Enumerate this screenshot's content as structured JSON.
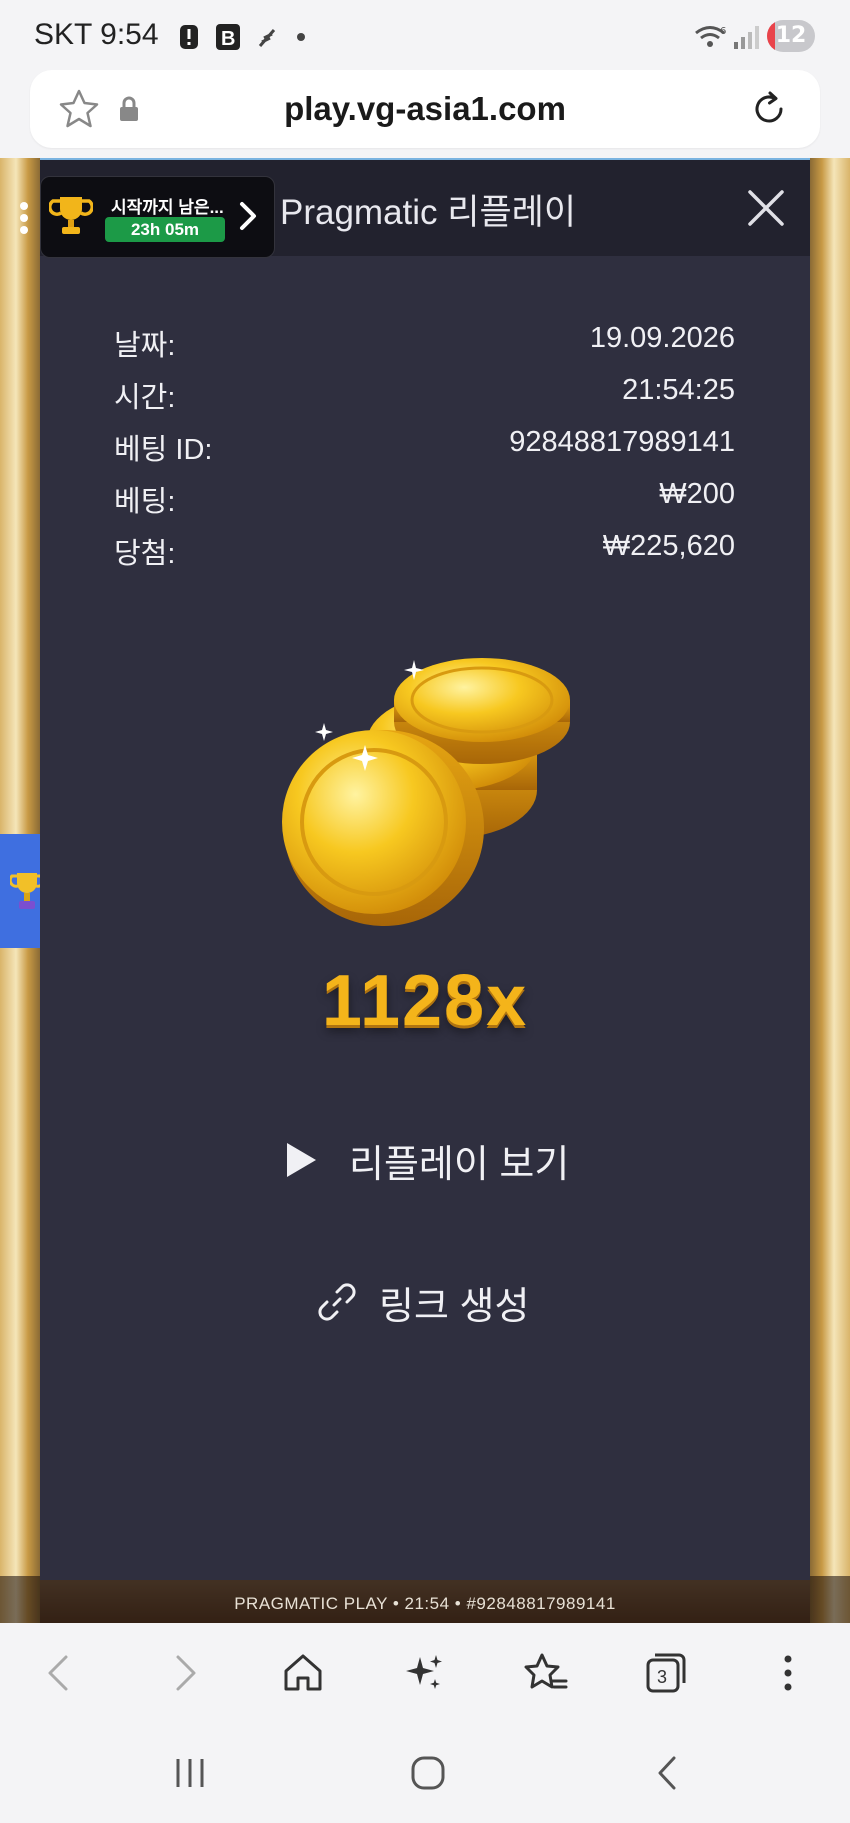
{
  "status_bar": {
    "carrier_time": "SKT 9:54",
    "battery_level": "12"
  },
  "url_bar": {
    "url": "play.vg-asia1.com"
  },
  "tournament": {
    "title": "시작까지 남은...",
    "timer": "23h 05m"
  },
  "modal": {
    "title": "Pragmatic 리플레이",
    "details": [
      {
        "label": "날짜:",
        "value": "19.09.2026"
      },
      {
        "label": "시간:",
        "value": "21:54:25"
      },
      {
        "label": "베팅 ID:",
        "value": "92848817989141"
      },
      {
        "label": "베팅:",
        "value": "₩200"
      },
      {
        "label": "당첨:",
        "value": "₩225,620"
      }
    ],
    "multiplier": "1128x",
    "replay_label": "리플레이 보기",
    "link_label": "링크 생성"
  },
  "game_footer": {
    "text": "PRAGMATIC PLAY • 21:54 • #92848817989141"
  },
  "icons": {
    "accent": "#f4b41a",
    "timer_green": "#1c9a47",
    "modal_bg": "#2f2f3f"
  }
}
